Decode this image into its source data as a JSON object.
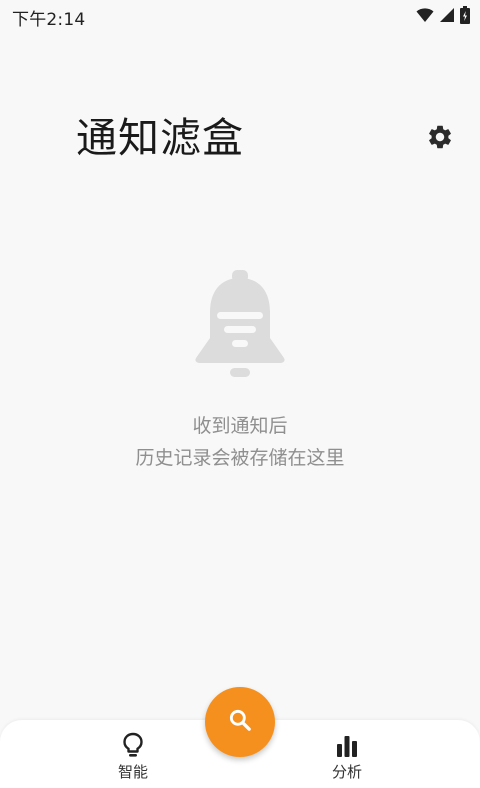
{
  "status_bar": {
    "time": "下午2:14",
    "icons": [
      "wifi-icon",
      "signal-icon",
      "battery-icon"
    ]
  },
  "header": {
    "title": "通知滤盒",
    "settings_icon": "gear-icon"
  },
  "empty_state": {
    "icon": "bell-icon",
    "line1": "收到通知后",
    "line2": "历史记录会被存储在这里"
  },
  "fab": {
    "icon": "search-icon",
    "color": "#f5901e"
  },
  "bottom_nav": {
    "items": [
      {
        "label": "智能",
        "icon": "lightbulb-icon"
      },
      {
        "label": "分析",
        "icon": "bar-chart-icon"
      }
    ]
  },
  "colors": {
    "background": "#f8f8f8",
    "accent": "#f5901e",
    "empty_text": "#8f8f8f",
    "illustration": "#dcdcdc"
  }
}
